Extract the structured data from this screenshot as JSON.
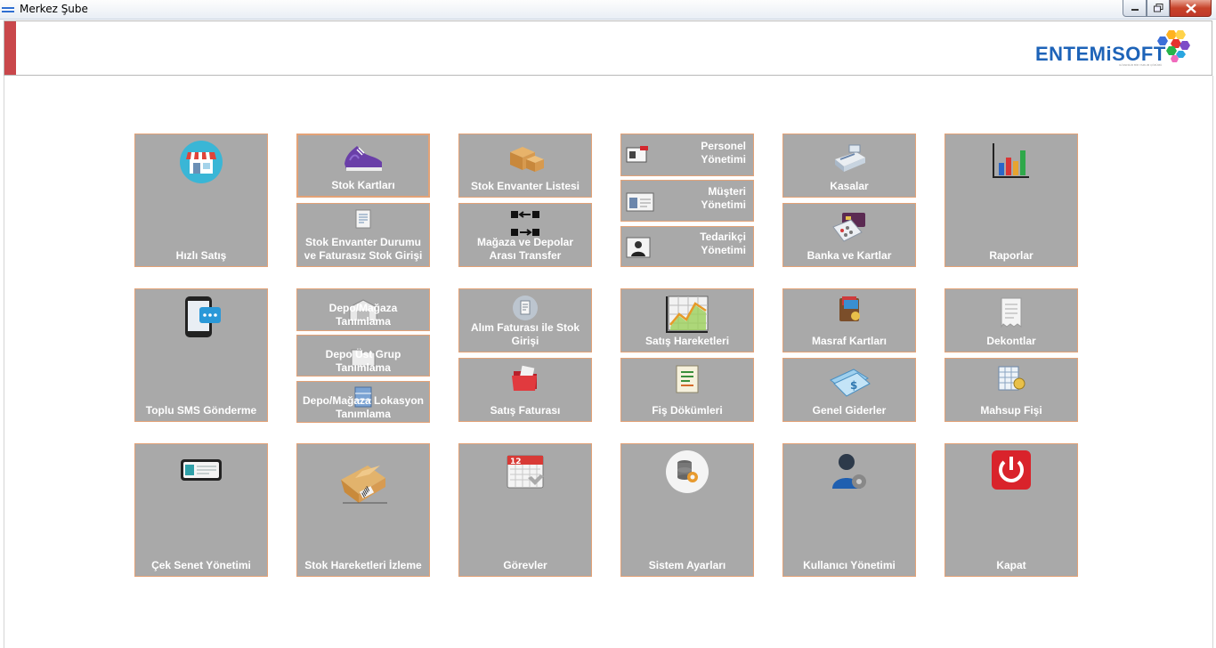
{
  "window": {
    "title": "Merkez Şube"
  },
  "brand": {
    "name_part1": "ENTEMi",
    "name_part2": "SOFT",
    "tagline": "GÜVENİLİR BİR YAZILIM ÇÖZÜMÜ"
  },
  "colors": {
    "tile_bg": "#a9a9a9",
    "tile_border": "#e3a277",
    "accent": "#c9474b",
    "brand": "#1d63b8"
  },
  "tiles": {
    "hizli_satis": "Hızlı Satış",
    "stok_kartlari": "Stok Kartları",
    "stok_envanter_durumu": "Stok Envanter Durumu ve Faturasız Stok Girişi",
    "stok_envanter_listesi": "Stok Envanter Listesi",
    "magaza_depolar_transfer": "Mağaza ve Depolar Arası Transfer",
    "personel_yonetimi": "Personel Yönetimi",
    "musteri_yonetimi": "Müşteri Yönetimi",
    "tedarikci_yonetimi": "Tedarikçi Yönetimi",
    "kasalar": "Kasalar",
    "banka_kartlar": "Banka ve Kartlar",
    "raporlar": "Raporlar",
    "toplu_sms": "Toplu SMS Gönderme",
    "depo_magaza_tanimlama": "Depo/Mağaza Tanımlama",
    "depo_ust_grup": "Depo Üst Grup Tanımlama",
    "depo_magaza_lokasyon": "Depo/Mağaza Lokasyon Tanımlama",
    "alim_faturasi": "Alım Faturası ile Stok Girişi",
    "satis_faturasi": "Satış Faturası",
    "satis_hareketleri": "Satış Hareketleri",
    "fis_dokumleri": "Fiş Dökümleri",
    "masraf_kartlari": "Masraf Kartları",
    "genel_giderler": "Genel Giderler",
    "dekontlar": "Dekontlar",
    "mahsup_fisi": "Mahsup Fişi",
    "cek_senet": "Çek Senet Yönetimi",
    "stok_hareketleri": "Stok Hareketleri İzleme",
    "gorevler": "Görevler",
    "sistem_ayarlari": "Sistem Ayarları",
    "kullanici_yonetimi": "Kullanıcı Yönetimi",
    "kapat": "Kapat"
  },
  "icons": {
    "calendar_day": "12"
  }
}
